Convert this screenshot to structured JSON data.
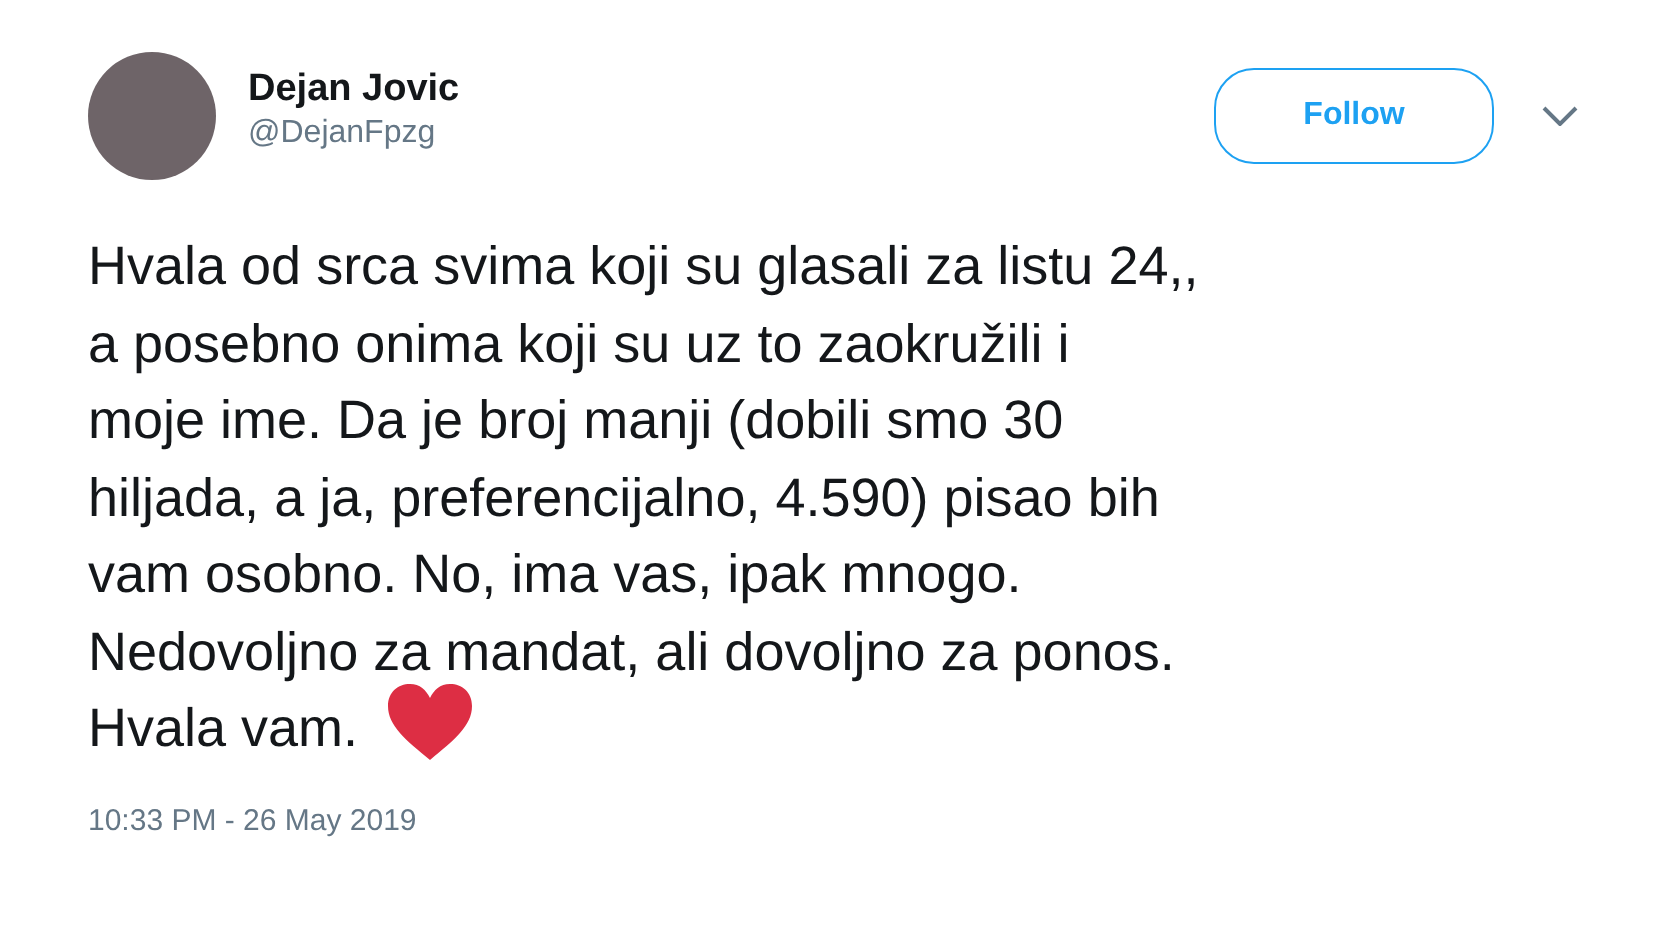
{
  "author": {
    "name": "Dejan Jovic",
    "handle": "@DejanFpzg"
  },
  "follow_button": {
    "label": "Follow"
  },
  "tweet": {
    "lines": [
      "Hvala od srca svima koji su glasali za listu 24,,",
      "a posebno onima koji su uz to zaokružili i",
      "moje ime. Da je broj manji (dobili smo 30",
      "hiljada, a ja, preferencijalno, 4.590) pisao bih",
      "vam osobno. No, ima vas, ipak mnogo.",
      "Nedovoljno za mandat, ali dovoljno za ponos.",
      "Hvala vam."
    ]
  },
  "timestamp": "10:33 PM - 26 May 2019"
}
